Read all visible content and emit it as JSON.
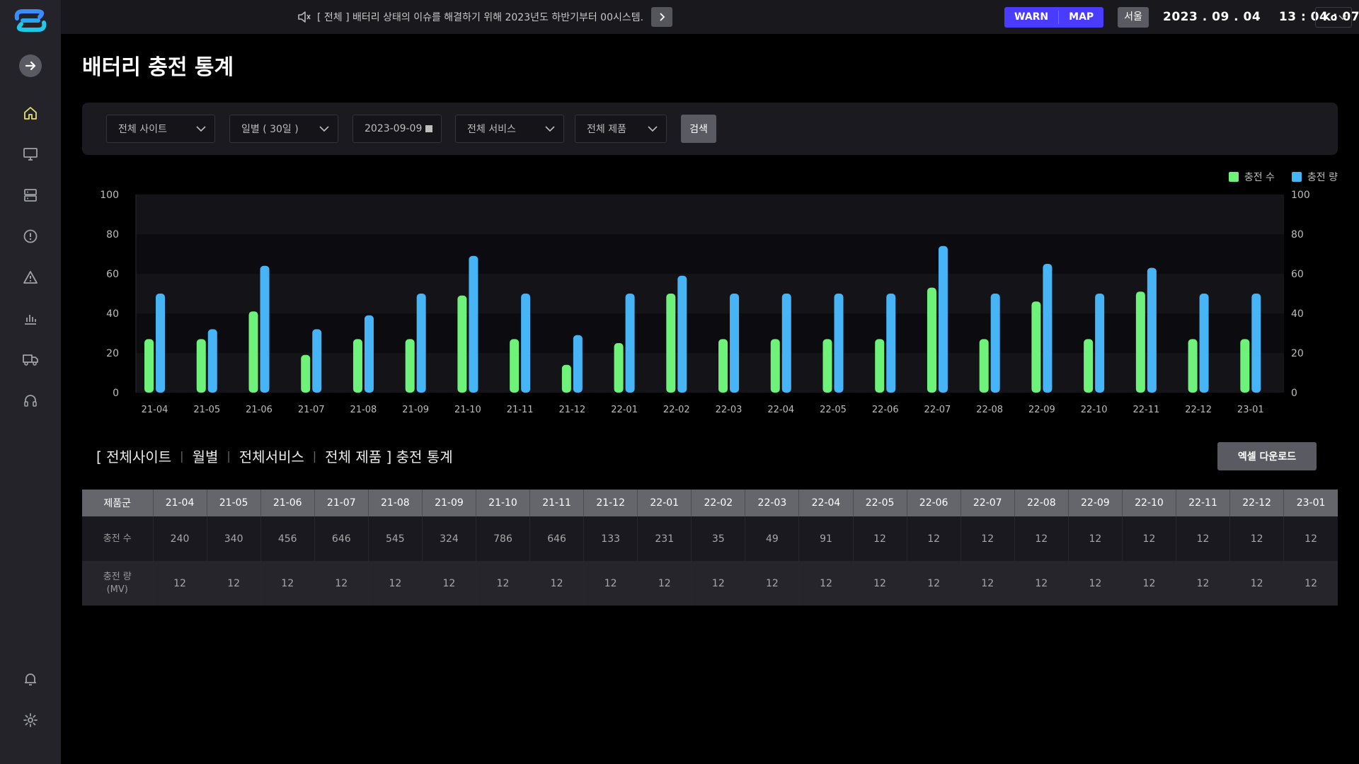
{
  "header": {
    "notice_text": "[ 전체 ]  배터리 상태의 이슈를 해결하기 위해 2023년도 하반기부터 00시스템...",
    "warn_label": "WARN",
    "map_label": "MAP",
    "region": "서울",
    "datetime": "2023 . 09 . 04    13 : 04 : 07",
    "lang": "Ko"
  },
  "page_title": "배터리 충전 통계",
  "filters": {
    "site": "전체 사이트",
    "period": "일별 ( 30일 )",
    "date": "2023-09-09",
    "service": "전체 서비스",
    "product": "전체 제품",
    "search_label": "검색"
  },
  "chart_data": {
    "type": "bar",
    "categories": [
      "21-04",
      "21-05",
      "21-06",
      "21-07",
      "21-08",
      "21-09",
      "21-10",
      "21-11",
      "21-12",
      "22-01",
      "22-02",
      "22-03",
      "22-04",
      "22-05",
      "22-06",
      "22-07",
      "22-08",
      "22-09",
      "22-10",
      "22-11",
      "22-12",
      "23-01"
    ],
    "series": [
      {
        "name": "충전 수",
        "color": "#6ef27a",
        "values": [
          27,
          27,
          41,
          19,
          27,
          27,
          49,
          27,
          14,
          25,
          50,
          27,
          27,
          27,
          27,
          53,
          27,
          46,
          27,
          51,
          27,
          27
        ]
      },
      {
        "name": "충전 량",
        "color": "#46b4f5",
        "values": [
          50,
          32,
          64,
          32,
          39,
          50,
          69,
          50,
          29,
          50,
          59,
          50,
          50,
          50,
          50,
          74,
          50,
          65,
          50,
          63,
          50,
          50
        ]
      }
    ],
    "y_ticks": [
      "0",
      "20",
      "40",
      "60",
      "80",
      "100"
    ],
    "ylim": [
      0,
      100
    ],
    "legend_position": "top-right"
  },
  "summary": {
    "open": "[ 전체사이트",
    "period": "월별",
    "service": "전체서비스",
    "close": "전체 제품 ] 충전 통계",
    "excel_label": "엑셀 다운로드"
  },
  "table": {
    "header_label": "제품군",
    "columns": [
      "21-04",
      "21-05",
      "21-06",
      "21-07",
      "21-08",
      "21-09",
      "21-10",
      "21-11",
      "21-12",
      "22-01",
      "22-02",
      "22-03",
      "22-04",
      "22-05",
      "22-06",
      "22-07",
      "22-08",
      "22-09",
      "22-10",
      "22-11",
      "22-12",
      "23-01"
    ],
    "rows": [
      {
        "label": "충전 수",
        "values": [
          "240",
          "340",
          "456",
          "646",
          "545",
          "324",
          "786",
          "646",
          "133",
          "231",
          "35",
          "49",
          "91",
          "12",
          "12",
          "12",
          "12",
          "12",
          "12",
          "12",
          "12",
          "12"
        ]
      },
      {
        "label_line1": "충전 량",
        "label_line2": "(MV)",
        "values": [
          "12",
          "12",
          "12",
          "12",
          "12",
          "12",
          "12",
          "12",
          "12",
          "12",
          "12",
          "12",
          "12",
          "12",
          "12",
          "12",
          "12",
          "12",
          "12",
          "12",
          "12",
          "12"
        ]
      }
    ]
  }
}
